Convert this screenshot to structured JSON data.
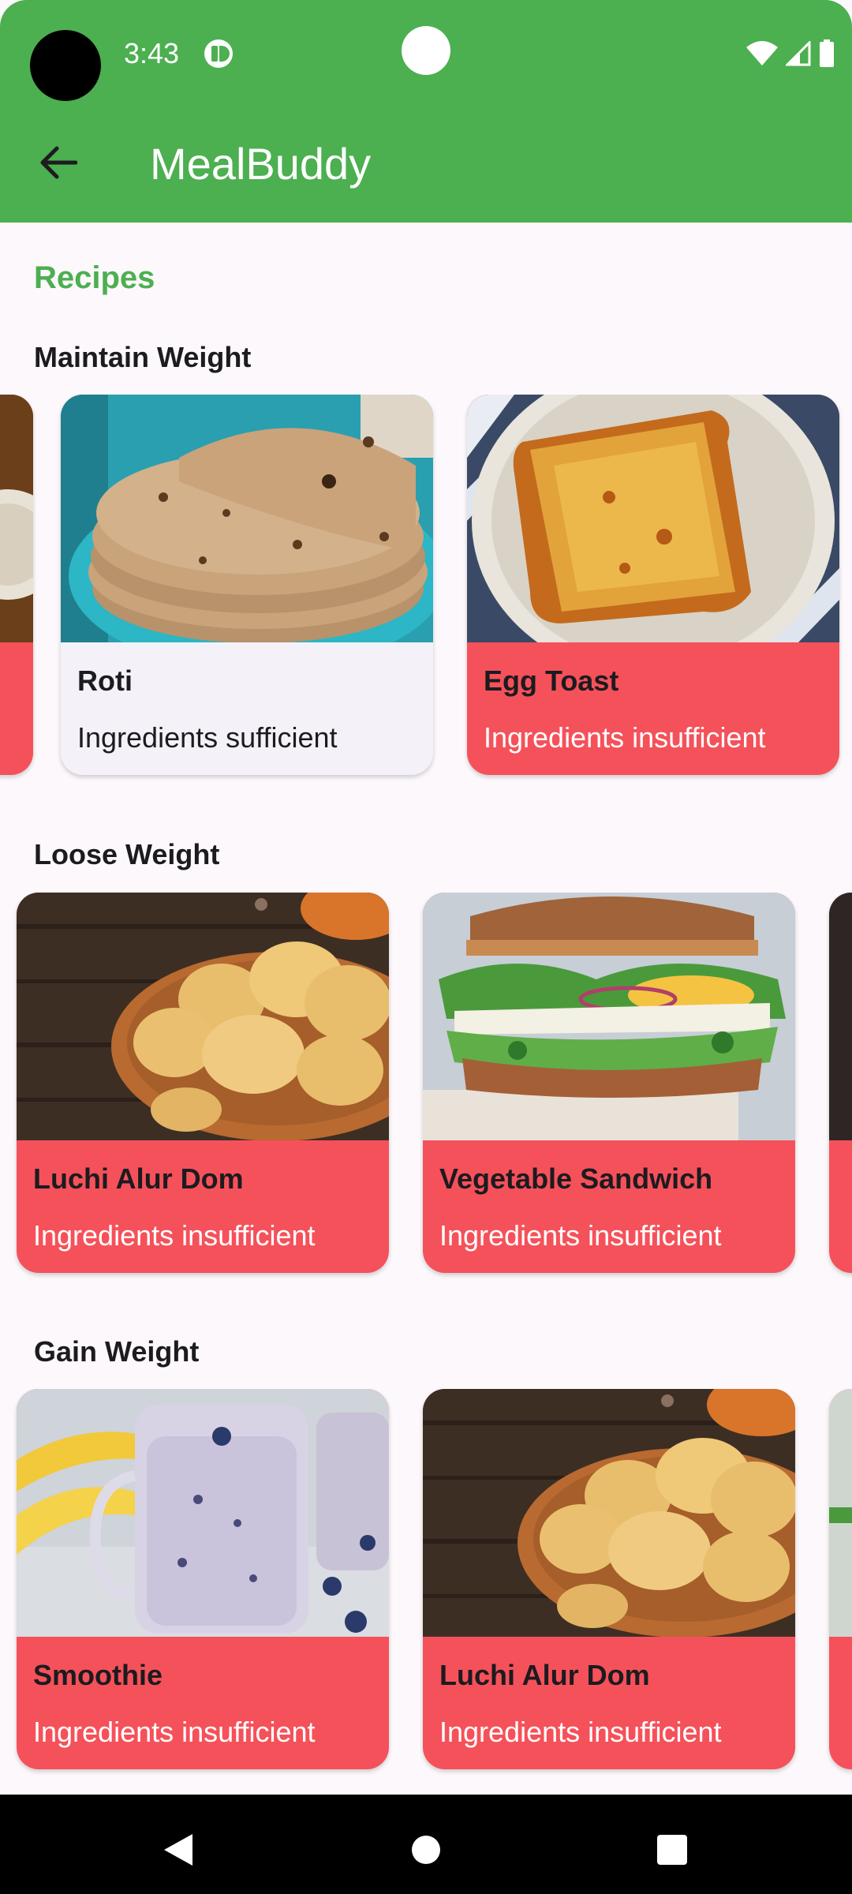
{
  "status_bar": {
    "time": "3:43"
  },
  "app_bar": {
    "title": "MealBuddy"
  },
  "page": {
    "heading": "Recipes",
    "groups": [
      {
        "title": "Maintain Weight",
        "cards": [
          {
            "name": "",
            "status": "",
            "state": "insufficient",
            "image": "partial-left-card"
          },
          {
            "name": "Roti",
            "status": "Ingredients sufficient",
            "state": "sufficient",
            "image": "roti-stack"
          },
          {
            "name": "Egg Toast",
            "status": "Ingredients insufficient",
            "state": "insufficient",
            "image": "egg-toast-plate"
          }
        ]
      },
      {
        "title": "Loose Weight",
        "cards": [
          {
            "name": "Luchi Alur Dom",
            "status": "Ingredients insufficient",
            "state": "insufficient",
            "image": "luchi-plate"
          },
          {
            "name": "Vegetable Sandwich",
            "status": "Ingredients insufficient",
            "state": "insufficient",
            "image": "vegetable-sandwich"
          },
          {
            "name": "",
            "status": "",
            "state": "insufficient",
            "image": "partial-right-card"
          }
        ]
      },
      {
        "title": "Gain Weight",
        "cards": [
          {
            "name": "Smoothie",
            "status": "Ingredients insufficient",
            "state": "insufficient",
            "image": "blueberry-smoothie"
          },
          {
            "name": "Luchi Alur Dom",
            "status": "Ingredients insufficient",
            "state": "insufficient",
            "image": "luchi-plate"
          },
          {
            "name": "",
            "status": "",
            "state": "insufficient",
            "image": "partial-right-card"
          }
        ]
      }
    ]
  },
  "colors": {
    "app_bar": "#4caf50",
    "insufficient_card": "#f5515a",
    "sufficient_card": "#f4f2f8",
    "heading": "#4caf50"
  },
  "icons": {
    "back": "arrow-back-icon",
    "nav_back": "triangle-back-icon",
    "nav_home": "circle-home-icon",
    "nav_recents": "square-recents-icon"
  }
}
